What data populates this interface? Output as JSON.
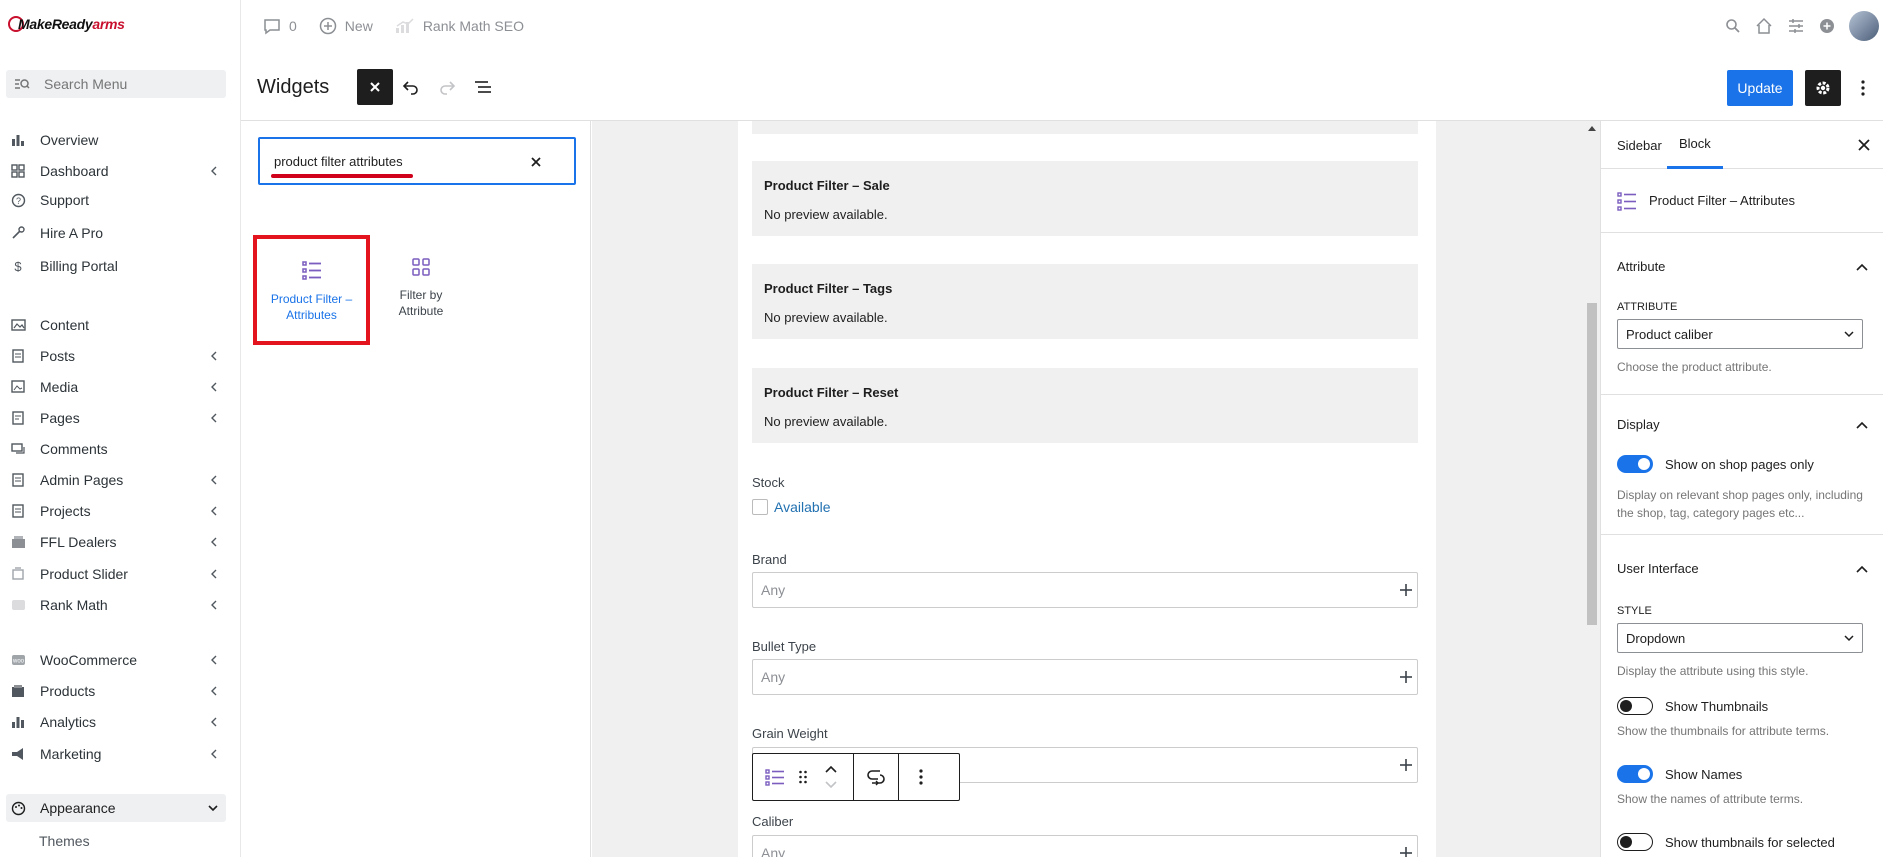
{
  "brand": {
    "name_main": "MakeReady",
    "name_accent": "arms"
  },
  "admin_menu": {
    "search_placeholder": "Search Menu",
    "items": [
      {
        "label": "Overview",
        "icon": "bar-chart-icon",
        "chevron": false
      },
      {
        "label": "Dashboard",
        "icon": "grid-icon",
        "chevron": true
      },
      {
        "label": "Support",
        "icon": "help-circle-icon",
        "chevron": false
      },
      {
        "label": "Hire A Pro",
        "icon": "tools-icon",
        "chevron": false
      },
      {
        "label": "Billing Portal",
        "icon": "dollar-icon",
        "chevron": false
      },
      {
        "label": "Content",
        "icon": "image-gallery-icon",
        "chevron": false
      },
      {
        "label": "Posts",
        "icon": "document-icon",
        "chevron": true
      },
      {
        "label": "Media",
        "icon": "media-icon",
        "chevron": true
      },
      {
        "label": "Pages",
        "icon": "page-icon",
        "chevron": true
      },
      {
        "label": "Comments",
        "icon": "comments-icon",
        "chevron": false
      },
      {
        "label": "Admin Pages",
        "icon": "admin-page-icon",
        "chevron": true
      },
      {
        "label": "Projects",
        "icon": "projects-icon",
        "chevron": true
      },
      {
        "label": "FFL Dealers",
        "icon": "dealer-icon",
        "chevron": true
      },
      {
        "label": "Product Slider",
        "icon": "slider-icon",
        "chevron": true
      },
      {
        "label": "Rank Math",
        "icon": "rank-math-icon",
        "chevron": true
      },
      {
        "label": "WooCommerce",
        "icon": "woocommerce-icon",
        "chevron": true
      },
      {
        "label": "Products",
        "icon": "products-icon",
        "chevron": true
      },
      {
        "label": "Analytics",
        "icon": "analytics-icon",
        "chevron": true
      },
      {
        "label": "Marketing",
        "icon": "megaphone-icon",
        "chevron": true
      },
      {
        "label": "Appearance",
        "icon": "palette-icon",
        "chevron": true
      }
    ],
    "submenu": {
      "themes": "Themes"
    }
  },
  "topbar": {
    "comments_count": "0",
    "new_label": "New",
    "seo_label": "Rank Math SEO"
  },
  "editor": {
    "title": "Widgets",
    "update_label": "Update"
  },
  "inserter": {
    "search_value": "product filter attributes",
    "results": [
      {
        "label": "Product Filter – Attributes"
      },
      {
        "label": "Filter by Attribute"
      }
    ]
  },
  "canvas": {
    "preview_blocks": [
      {
        "title": "Product Filter – Sale",
        "message": "No preview available."
      },
      {
        "title": "Product Filter – Tags",
        "message": "No preview available."
      },
      {
        "title": "Product Filter – Reset",
        "message": "No preview available."
      }
    ],
    "stock": {
      "label": "Stock",
      "option": "Available"
    },
    "fields": [
      {
        "label": "Brand",
        "placeholder": "Any"
      },
      {
        "label": "Bullet Type",
        "placeholder": "Any"
      },
      {
        "label": "Grain Weight",
        "placeholder": ""
      },
      {
        "label": "Caliber",
        "placeholder": "Any"
      }
    ]
  },
  "sidebar": {
    "tabs": [
      "Sidebar",
      "Block"
    ],
    "block_title": "Product Filter – Attributes",
    "attribute_panel": {
      "title": "Attribute",
      "field_label": "ATTRIBUTE",
      "selected": "Product caliber",
      "help": "Choose the product attribute."
    },
    "display_panel": {
      "title": "Display",
      "toggle_label": "Show on shop pages only",
      "toggle_on": true,
      "help": "Display on relevant shop pages only, including the shop, tag, category pages etc..."
    },
    "ui_panel": {
      "title": "User Interface",
      "style_label": "STYLE",
      "style_selected": "Dropdown",
      "style_help": "Display the attribute using this style.",
      "toggles": [
        {
          "label": "Show Thumbnails",
          "on": false,
          "help": "Show the thumbnails for attribute terms."
        },
        {
          "label": "Show Names",
          "on": true,
          "help": "Show the names of attribute terms."
        },
        {
          "label": "Show thumbnails for selected",
          "on": false,
          "help": ""
        }
      ]
    }
  },
  "colors": {
    "accent": "#1a73e8",
    "highlight": "#e3141d",
    "block_icon": "#7b5dbf"
  }
}
